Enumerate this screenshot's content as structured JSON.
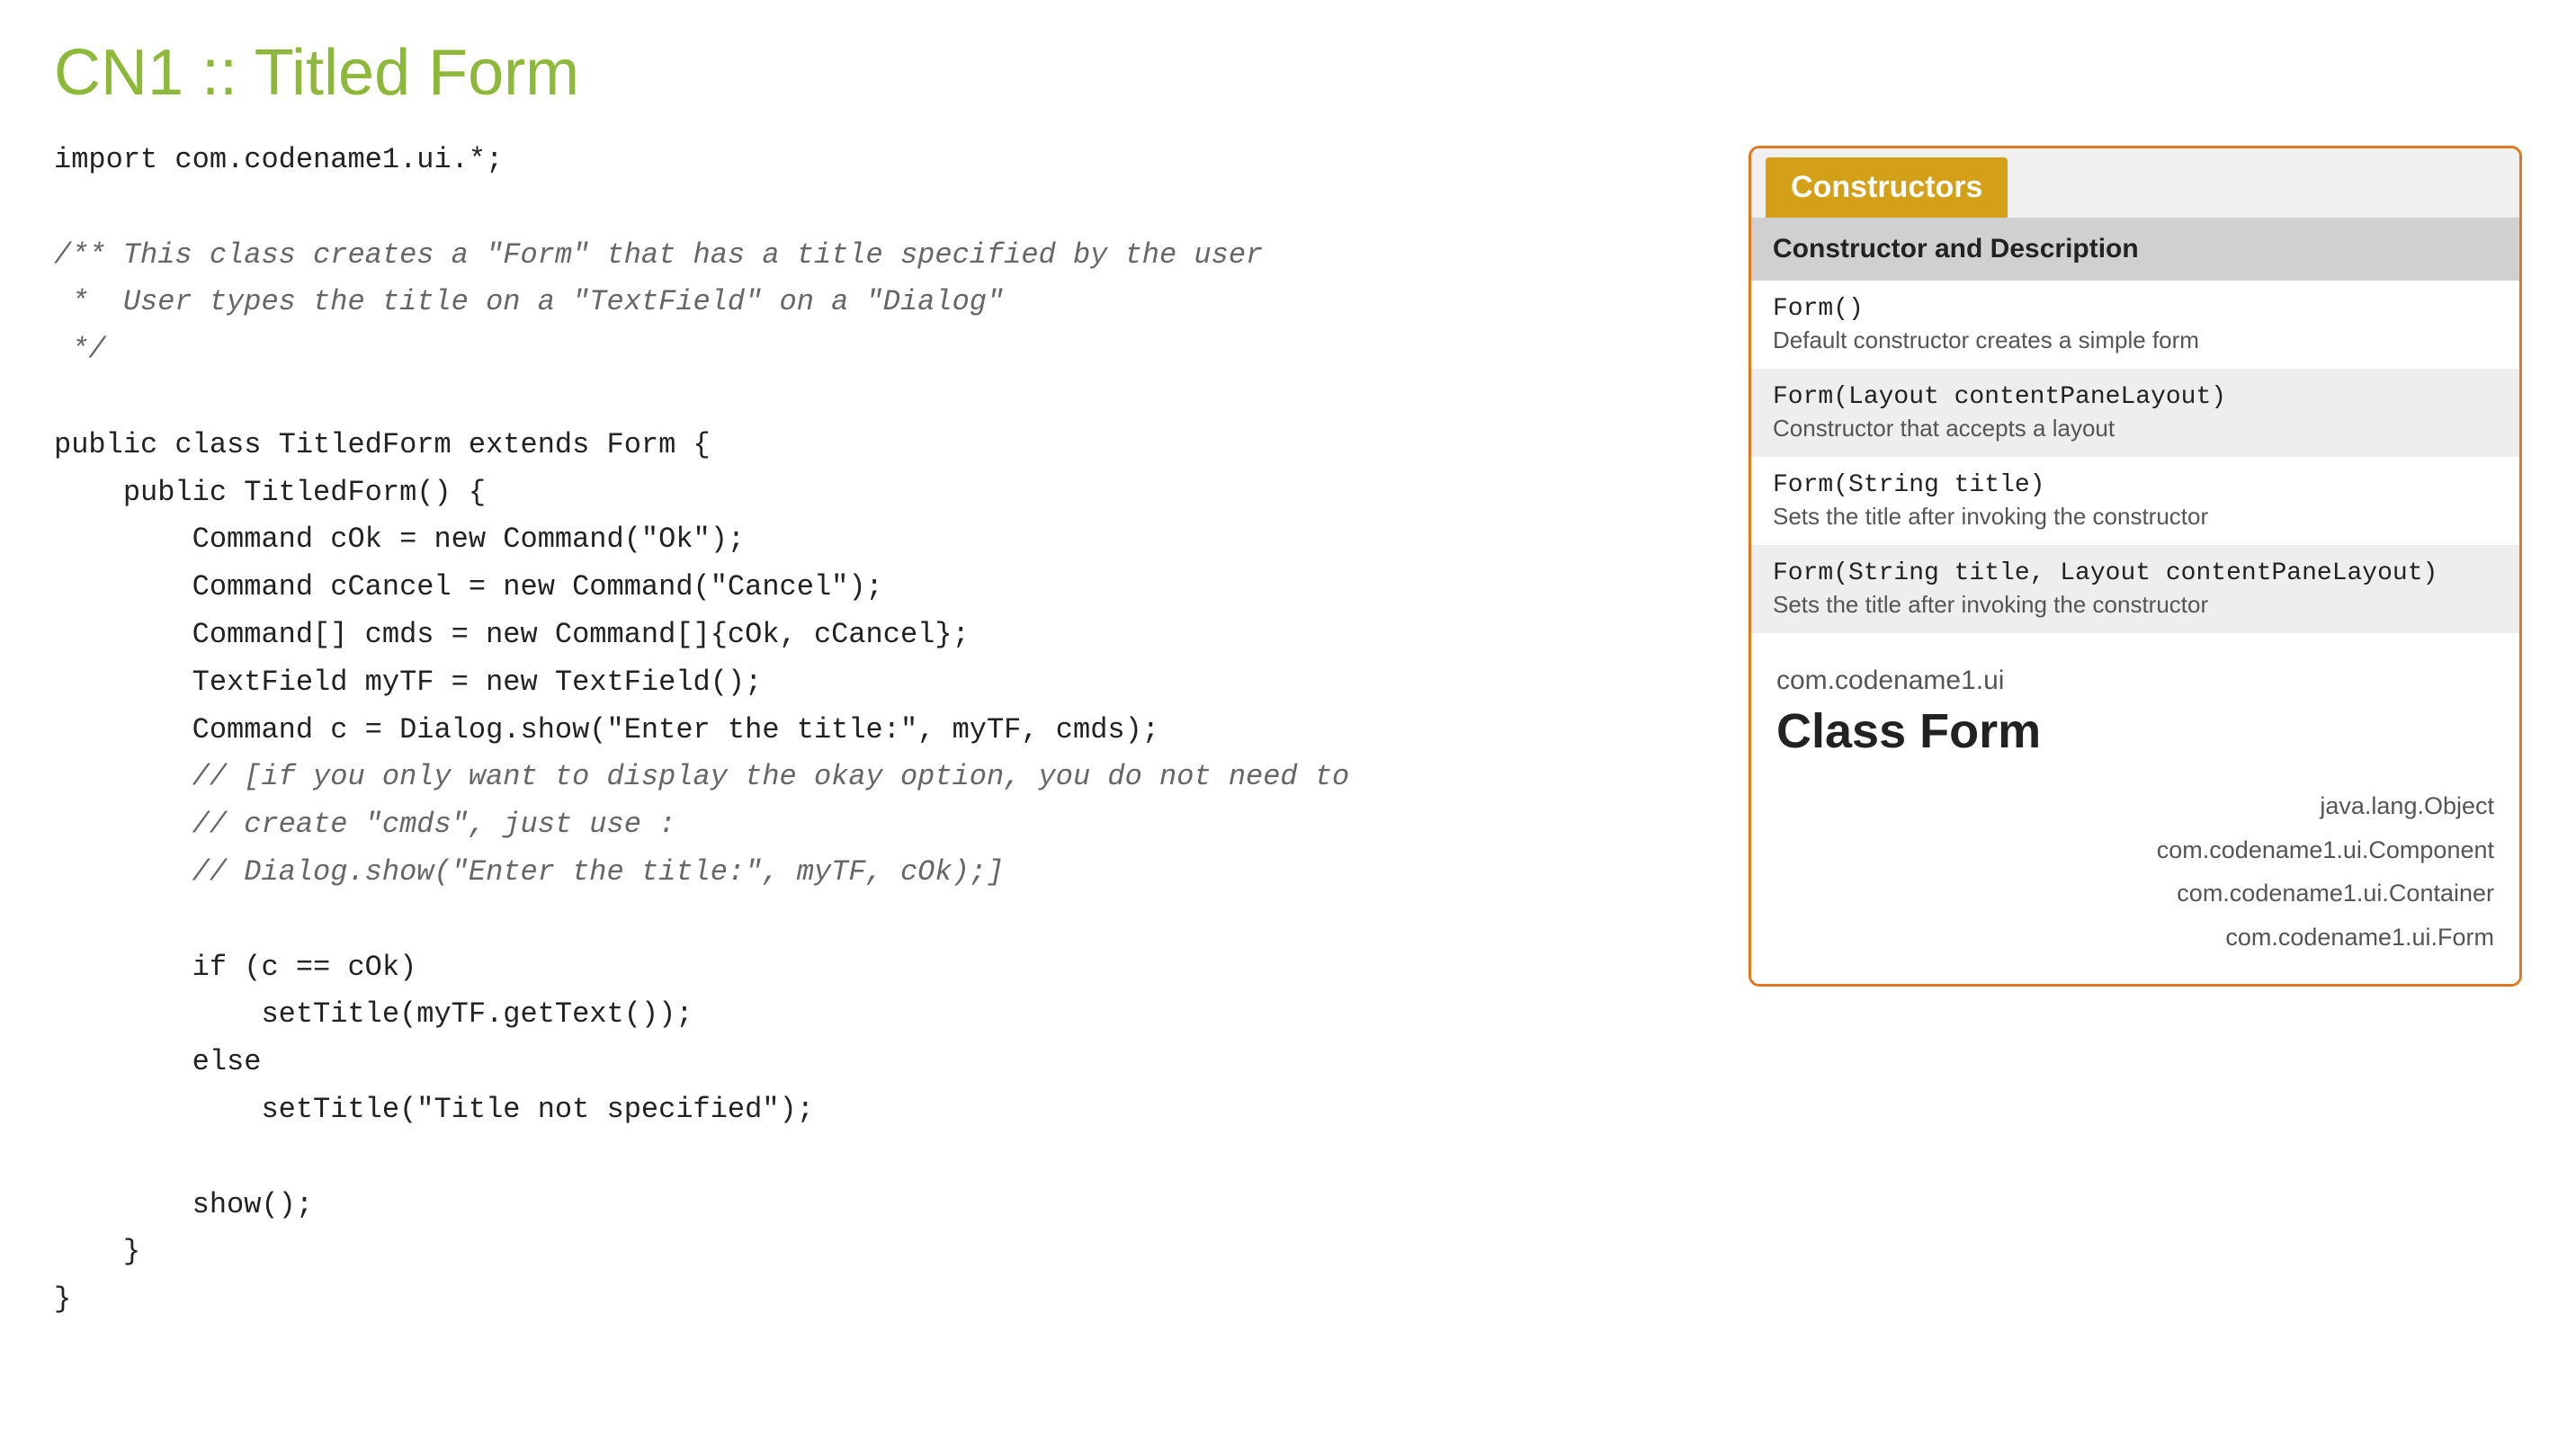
{
  "page": {
    "title": "CN1 :: Titled Form"
  },
  "code": {
    "lines": [
      {
        "type": "normal",
        "text": "import com.codename1.ui.*;"
      },
      {
        "type": "blank",
        "text": ""
      },
      {
        "type": "comment",
        "text": "/** This class creates a \"Form\" that has a title specified by the user"
      },
      {
        "type": "comment",
        "text": " *  User types the title on a \"TextField\" on a \"Dialog\""
      },
      {
        "type": "comment",
        "text": " */"
      },
      {
        "type": "blank",
        "text": ""
      },
      {
        "type": "normal",
        "text": "public class TitledForm extends Form {"
      },
      {
        "type": "normal",
        "text": "    public TitledForm() {"
      },
      {
        "type": "normal",
        "text": "        Command cOk = new Command(\"Ok\");"
      },
      {
        "type": "normal",
        "text": "        Command cCancel = new Command(\"Cancel\");"
      },
      {
        "type": "normal",
        "text": "        Command[] cmds = new Command[]{cOk, cCancel};"
      },
      {
        "type": "normal",
        "text": "        TextField myTF = new TextField();"
      },
      {
        "type": "normal",
        "text": "        Command c = Dialog.show(\"Enter the title:\", myTF, cmds);"
      },
      {
        "type": "comment",
        "text": "        // [if you only want to display the okay option, you do not need to"
      },
      {
        "type": "comment",
        "text": "        // create \"cmds\", just use :"
      },
      {
        "type": "comment",
        "text": "        // Dialog.show(\"Enter the title:\", myTF, cOk);]"
      },
      {
        "type": "blank",
        "text": ""
      },
      {
        "type": "normal",
        "text": "        if (c == cOk)"
      },
      {
        "type": "normal",
        "text": "            setTitle(myTF.getText());"
      },
      {
        "type": "normal",
        "text": "        else"
      },
      {
        "type": "normal",
        "text": "            setTitle(\"Title not specified\");"
      },
      {
        "type": "blank",
        "text": ""
      },
      {
        "type": "normal",
        "text": "        show();"
      },
      {
        "type": "normal",
        "text": "    }"
      },
      {
        "type": "normal",
        "text": "}"
      }
    ]
  },
  "panel": {
    "tab_label": "Constructors",
    "table_header": "Constructor and Description",
    "constructors": [
      {
        "sig": "Form()",
        "desc": "Default constructor creates a simple form"
      },
      {
        "sig": "Form(Layout contentPaneLayout)",
        "desc": "Constructor that accepts a layout"
      },
      {
        "sig": "Form(String title)",
        "desc": "Sets the title after invoking the constructor"
      },
      {
        "sig": "Form(String title, Layout contentPaneLayout)",
        "desc": "Sets the title after invoking the constructor"
      }
    ],
    "class_info": {
      "package": "com.codename1.ui",
      "class_name": "Class Form",
      "hierarchy": [
        "java.lang.Object",
        "com.codename1.ui.Component",
        "com.codename1.ui.Container",
        "com.codename1.ui.Form"
      ]
    }
  }
}
